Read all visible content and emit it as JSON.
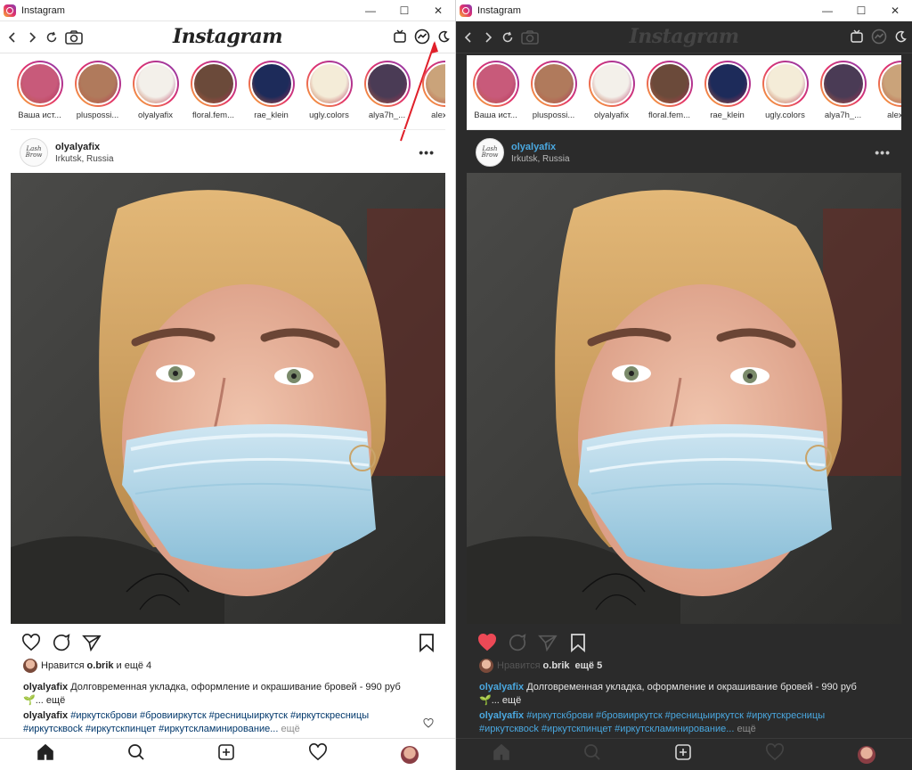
{
  "window": {
    "title": "Instagram",
    "minimize": "—",
    "maximize": "☐",
    "close": "✕"
  },
  "app": {
    "wordmark": "Instagram"
  },
  "stories": [
    {
      "label": "Ваша ист...",
      "color": "#c85a7a"
    },
    {
      "label": "pluspossi...",
      "color": "#b07a5c"
    },
    {
      "label": "olyalyafix",
      "color": "#f3f0ea"
    },
    {
      "label": "floral.fem...",
      "color": "#6b4a3a"
    },
    {
      "label": "rae_klein",
      "color": "#1d2b5a"
    },
    {
      "label": "ugly.colors",
      "color": "#f4ecd8"
    },
    {
      "label": "alya7h_...",
      "color": "#4a3b55"
    },
    {
      "label": "alexa...",
      "color": "#caa37a"
    }
  ],
  "post": {
    "avatar_text": "Lash Brow",
    "username": "olyalyafix",
    "location": "Irkutsk, Russia",
    "more": "•••",
    "caption_user": "olyalyafix",
    "caption_text": " Долговременная укладка, оформление и окрашивание бровей - 990 руб",
    "caption_more": "🌱... ещё",
    "tags_user": "olyalyafix",
    "tags_text": " #иркутскброви #бровииркутск #ресницыиркутск #иркутскресницы #иркутсквосk #иркутскпинцет #иркутскламинирование...",
    "tags_more": " ещё"
  },
  "light": {
    "likes_prefix": "Нравится",
    "likes_user": "o.brik",
    "likes_suffix": "и ещё 4"
  },
  "dark": {
    "likes_prefix": "Нравится",
    "likes_user": "o.brik",
    "likes_suffix": "ещё 5"
  },
  "colors": {
    "accent_red": "#ed4956",
    "link_blue": "#4aa8e0",
    "annotation_red": "#e0202a"
  }
}
